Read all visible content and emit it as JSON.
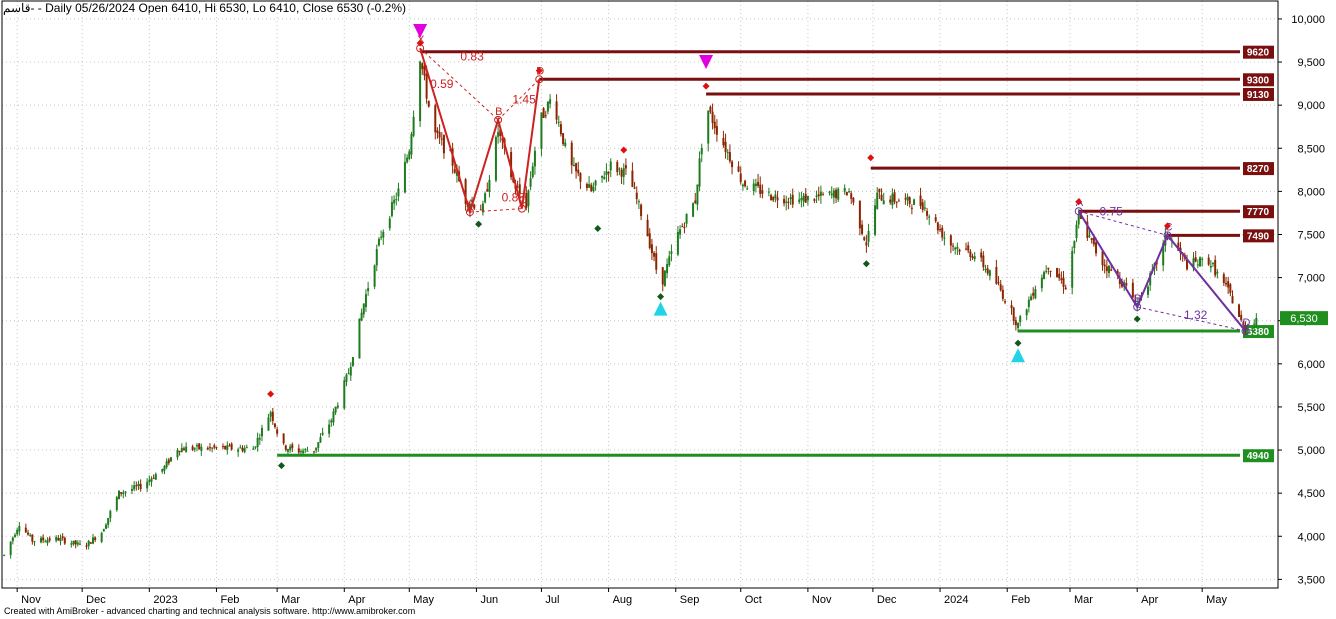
{
  "header": {
    "symbol": "قاسم‐",
    "rest": " - Daily 05/26/2024 Open 6410, Hi 6530, Lo 6410, Close 6530 (-0.2%)"
  },
  "footer": {
    "text": "Created with AmiBroker - advanced charting and technical analysis software. http://www.amibroker.com"
  },
  "chart_data": {
    "type": "candlestick",
    "title": "",
    "ylim": [
      3400,
      10150
    ],
    "y_ticks": [
      3500,
      4000,
      4500,
      5000,
      5500,
      6000,
      6500,
      7000,
      7500,
      8000,
      8500,
      9000,
      9500,
      10000
    ],
    "y_tick_labels": [
      "3,500",
      "4,000",
      "4,500",
      "5,000",
      "5,500",
      "6,000",
      "6,500",
      "7,000",
      "7,500",
      "8,000",
      "8,500",
      "9,000",
      "9,500",
      "10,000"
    ],
    "x_range": [
      "2022-10-25",
      "2024-06-05"
    ],
    "x_labels": [
      {
        "date": "2022-11-01",
        "label": "Nov"
      },
      {
        "date": "2022-12-01",
        "label": "Dec"
      },
      {
        "date": "2023-01-01",
        "label": "2023"
      },
      {
        "date": "2023-02-01",
        "label": "Feb"
      },
      {
        "date": "2023-03-01",
        "label": "Mar"
      },
      {
        "date": "2023-04-01",
        "label": "Apr"
      },
      {
        "date": "2023-05-01",
        "label": "May"
      },
      {
        "date": "2023-06-01",
        "label": "Jun"
      },
      {
        "date": "2023-07-01",
        "label": "Jul"
      },
      {
        "date": "2023-08-01",
        "label": "Aug"
      },
      {
        "date": "2023-09-01",
        "label": "Sep"
      },
      {
        "date": "2023-10-01",
        "label": "Oct"
      },
      {
        "date": "2023-11-01",
        "label": "Nov"
      },
      {
        "date": "2023-12-01",
        "label": "Dec"
      },
      {
        "date": "2024-01-01",
        "label": "2024"
      },
      {
        "date": "2024-02-01",
        "label": "Feb"
      },
      {
        "date": "2024-03-01",
        "label": "Mar"
      },
      {
        "date": "2024-04-01",
        "label": "Apr"
      },
      {
        "date": "2024-05-01",
        "label": "May"
      }
    ],
    "price_path": [
      [
        "2022-10-26",
        3780
      ],
      [
        "2022-11-02",
        4150
      ],
      [
        "2022-11-08",
        3950
      ],
      [
        "2022-11-20",
        3970
      ],
      [
        "2022-12-02",
        3880
      ],
      [
        "2022-12-10",
        4050
      ],
      [
        "2022-12-18",
        4500
      ],
      [
        "2022-12-28",
        4580
      ],
      [
        "2023-01-08",
        4800
      ],
      [
        "2023-01-14",
        5020
      ],
      [
        "2023-02-01",
        5020
      ],
      [
        "2023-02-10",
        5020
      ],
      [
        "2023-02-18",
        5020
      ],
      [
        "2023-02-26",
        5450
      ],
      [
        "2023-03-03",
        5050
      ],
      [
        "2023-03-10",
        4990
      ],
      [
        "2023-03-18",
        5000
      ],
      [
        "2023-03-26",
        5350
      ],
      [
        "2023-04-03",
        5900
      ],
      [
        "2023-04-10",
        6700
      ],
      [
        "2023-04-18",
        7500
      ],
      [
        "2023-04-26",
        8000
      ],
      [
        "2023-05-01",
        8500
      ],
      [
        "2023-05-06",
        9560
      ],
      [
        "2023-05-12",
        8700
      ],
      [
        "2023-05-20",
        8400
      ],
      [
        "2023-05-27",
        7900
      ],
      [
        "2023-06-04",
        7800
      ],
      [
        "2023-06-11",
        8700
      ],
      [
        "2023-06-18",
        8100
      ],
      [
        "2023-06-24",
        7850
      ],
      [
        "2023-06-30",
        8800
      ],
      [
        "2023-07-06",
        9100
      ],
      [
        "2023-07-14",
        8300
      ],
      [
        "2023-07-24",
        8000
      ],
      [
        "2023-08-02",
        8300
      ],
      [
        "2023-08-10",
        8200
      ],
      [
        "2023-08-18",
        7600
      ],
      [
        "2023-08-25",
        6900
      ],
      [
        "2023-09-02",
        7500
      ],
      [
        "2023-09-10",
        7900
      ],
      [
        "2023-09-15",
        9000
      ],
      [
        "2023-09-22",
        8600
      ],
      [
        "2023-10-02",
        8100
      ],
      [
        "2023-10-15",
        7950
      ],
      [
        "2023-10-28",
        7900
      ],
      [
        "2023-11-10",
        7950
      ],
      [
        "2023-11-20",
        8000
      ],
      [
        "2023-11-28",
        7400
      ],
      [
        "2023-12-03",
        7950
      ],
      [
        "2023-12-12",
        7900
      ],
      [
        "2023-12-24",
        7850
      ],
      [
        "2024-01-05",
        7400
      ],
      [
        "2024-01-18",
        7250
      ],
      [
        "2024-01-28",
        6900
      ],
      [
        "2024-02-06",
        6450
      ],
      [
        "2024-02-14",
        6900
      ],
      [
        "2024-02-20",
        7150
      ],
      [
        "2024-02-28",
        6900
      ],
      [
        "2024-03-05",
        7700
      ],
      [
        "2024-03-15",
        7200
      ],
      [
        "2024-03-25",
        6950
      ],
      [
        "2024-04-01",
        6700
      ],
      [
        "2024-04-08",
        7050
      ],
      [
        "2024-04-15",
        7500
      ],
      [
        "2024-04-24",
        7150
      ],
      [
        "2024-05-04",
        7200
      ],
      [
        "2024-05-14",
        6800
      ],
      [
        "2024-05-20",
        6420
      ],
      [
        "2024-05-26",
        6530
      ]
    ],
    "levels": [
      {
        "from": "2023-05-06",
        "value": 9620,
        "label": "9620",
        "color": "#7a0f0f"
      },
      {
        "from": "2023-06-30",
        "value": 9300,
        "label": "9300",
        "color": "#7a0f0f"
      },
      {
        "from": "2023-09-15",
        "value": 9130,
        "label": "9130",
        "color": "#7a0f0f"
      },
      {
        "from": "2023-11-30",
        "value": 8270,
        "label": "8270",
        "color": "#7a0f0f"
      },
      {
        "from": "2024-03-05",
        "value": 7770,
        "label": "7770",
        "color": "#7a0f0f"
      },
      {
        "from": "2024-04-15",
        "value": 7490,
        "label": "7490",
        "color": "#7a0f0f"
      },
      {
        "from": "2024-02-06",
        "value": 6380,
        "label": "6380",
        "color": "#1f8f1f"
      },
      {
        "from": "2023-03-01",
        "value": 4940,
        "label": "4940",
        "color": "#1f8f1f"
      }
    ],
    "last_price": {
      "value": 6530,
      "label": "6,530"
    },
    "patterns": [
      {
        "color": "#cc2222",
        "points": [
          {
            "name": "X",
            "date": "2023-05-06",
            "value": 9660
          },
          {
            "name": "A",
            "date": "2023-05-29",
            "value": 7760
          },
          {
            "name": "B",
            "date": "2023-06-11",
            "value": 8830
          },
          {
            "name": "C",
            "date": "2023-06-22",
            "value": 7800
          },
          {
            "name": "D",
            "date": "2023-06-30",
            "value": 9300
          }
        ],
        "ratios": [
          {
            "label": "0.83",
            "date": "2023-05-30",
            "value": 9520
          },
          {
            "label": "0.59",
            "date": "2023-05-16",
            "value": 9200
          },
          {
            "label": "1.45",
            "date": "2023-06-23",
            "value": 9020
          },
          {
            "label": "0.88",
            "date": "2023-06-18",
            "value": 7880
          }
        ]
      },
      {
        "color": "#7030a0",
        "points": [
          {
            "name": "A",
            "date": "2024-03-05",
            "value": 7770
          },
          {
            "name": "B",
            "date": "2024-04-01",
            "value": 6660
          },
          {
            "name": "C",
            "date": "2024-04-15",
            "value": 7490
          },
          {
            "name": "D",
            "date": "2024-05-21",
            "value": 6380
          }
        ],
        "ratios": [
          {
            "label": "0.75",
            "date": "2024-03-20",
            "value": 7720
          },
          {
            "label": "1.32",
            "date": "2024-04-28",
            "value": 6520
          }
        ]
      }
    ],
    "markers_up": [
      {
        "date": "2023-08-25",
        "value": 6640,
        "color": "#22d3e6"
      },
      {
        "date": "2024-02-06",
        "value": 6100,
        "color": "#22d3e6"
      }
    ],
    "markers_down": [
      {
        "date": "2023-05-06",
        "value": 9860,
        "color": "#e000e0"
      },
      {
        "date": "2023-09-15",
        "value": 9500,
        "color": "#e000e0"
      }
    ],
    "pivot_highs": [
      [
        "2023-02-26",
        5650
      ],
      [
        "2023-05-06",
        9720
      ],
      [
        "2023-06-30",
        9400
      ],
      [
        "2023-08-08",
        8480
      ],
      [
        "2023-09-15",
        9220
      ],
      [
        "2023-11-30",
        8390
      ],
      [
        "2024-03-05",
        7880
      ],
      [
        "2024-04-15",
        7600
      ]
    ],
    "pivot_lows": [
      [
        "2023-03-03",
        4820
      ],
      [
        "2023-06-02",
        7620
      ],
      [
        "2023-07-27",
        7570
      ],
      [
        "2023-08-25",
        6780
      ],
      [
        "2023-11-28",
        7160
      ],
      [
        "2024-02-06",
        6240
      ],
      [
        "2024-04-01",
        6520
      ]
    ]
  }
}
